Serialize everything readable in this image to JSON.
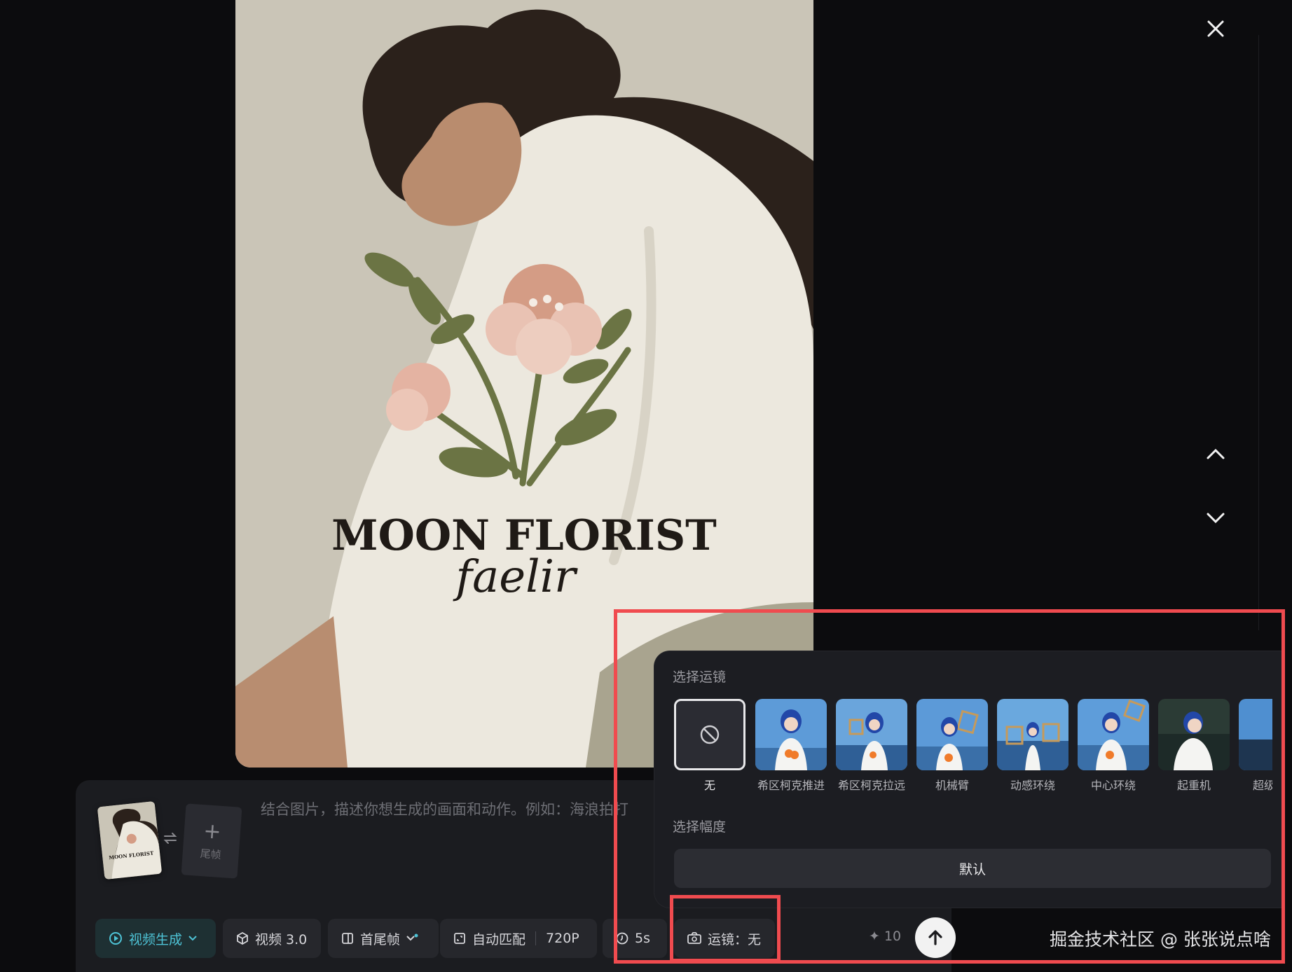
{
  "poster": {
    "title": "MOON FLORIST",
    "script": "faelir"
  },
  "controls": {
    "close_icon": "close-icon",
    "up_icon": "chevron-up-icon",
    "down_icon": "chevron-down-icon"
  },
  "composer": {
    "tail_frame_label": "尾帧",
    "prompt_placeholder": "结合图片，描述你想生成的画面和动作。例如：海浪拍打",
    "mode": "视频生成",
    "model": "视频 3.0",
    "frame_mode": "首尾帧",
    "ratio": "自动匹配",
    "resolution": "720P",
    "duration": "5s",
    "camera": "运镜：无",
    "credits": "10"
  },
  "camera_panel": {
    "title": "选择运镜",
    "options": [
      {
        "label": "无",
        "selected": true
      },
      {
        "label": "希区柯克推进"
      },
      {
        "label": "希区柯克拉远"
      },
      {
        "label": "机械臂"
      },
      {
        "label": "动感环绕"
      },
      {
        "label": "中心环绕"
      },
      {
        "label": "起重机"
      },
      {
        "label": "超级"
      }
    ],
    "amplitude_title": "选择幅度",
    "amplitude_value": "默认"
  },
  "watermark": "掘金技术社区 @ 张张说点啥",
  "colors": {
    "accent_cyan": "#4ec3d6",
    "highlight_red": "#f04b4f",
    "panel_bg": "#1c1d22"
  }
}
